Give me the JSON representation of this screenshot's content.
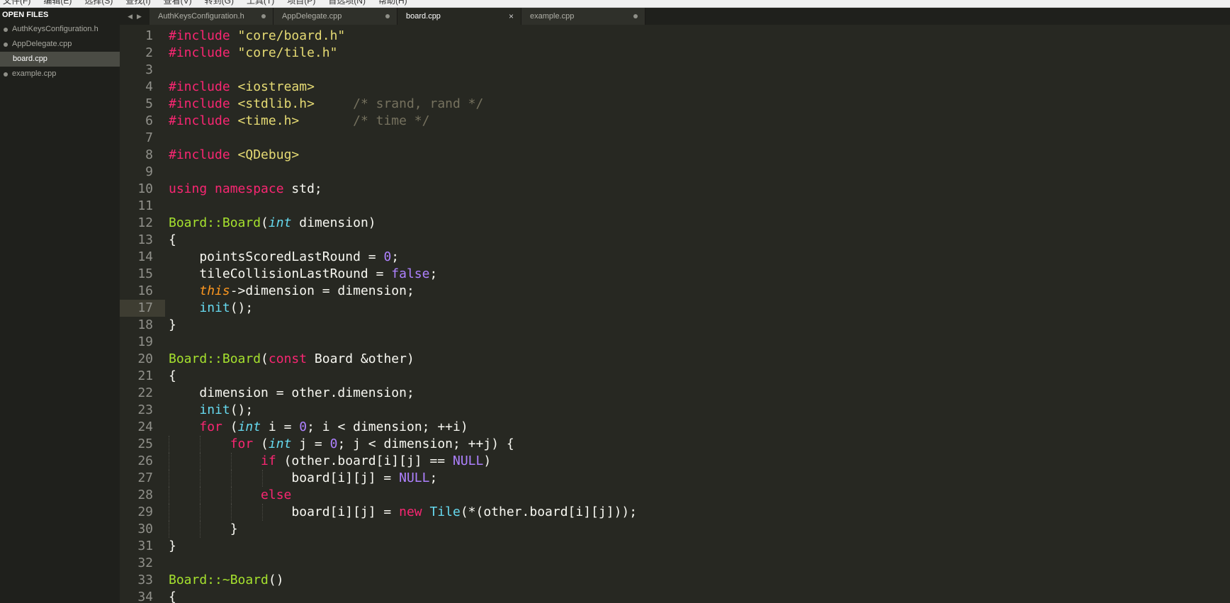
{
  "menu": [
    "文件(F)",
    "编辑(E)",
    "选择(S)",
    "查找(I)",
    "查看(V)",
    "转到(G)",
    "工具(T)",
    "项目(P)",
    "首选项(N)",
    "帮助(H)"
  ],
  "sidebar": {
    "header": "OPEN FILES",
    "files": [
      {
        "name": "AuthKeysConfiguration.h",
        "active": false
      },
      {
        "name": "AppDelegate.cpp",
        "active": false
      },
      {
        "name": "board.cpp",
        "active": true
      },
      {
        "name": "example.cpp",
        "active": false
      }
    ]
  },
  "tabs": [
    {
      "name": "AuthKeysConfiguration.h",
      "active": false
    },
    {
      "name": "AppDelegate.cpp",
      "active": false
    },
    {
      "name": "board.cpp",
      "active": true,
      "close": "×"
    },
    {
      "name": "example.cpp",
      "active": false
    }
  ],
  "editor": {
    "current_line": 17,
    "lines": [
      [
        [
          "kw",
          "#include"
        ],
        [
          "pl",
          " "
        ],
        [
          "str",
          "\"core/board.h\""
        ]
      ],
      [
        [
          "kw",
          "#include"
        ],
        [
          "pl",
          " "
        ],
        [
          "str",
          "\"core/tile.h\""
        ]
      ],
      [],
      [
        [
          "kw",
          "#include"
        ],
        [
          "pl",
          " "
        ],
        [
          "str",
          "<iostream>"
        ]
      ],
      [
        [
          "kw",
          "#include"
        ],
        [
          "pl",
          " "
        ],
        [
          "str",
          "<stdlib.h>"
        ],
        [
          "pl",
          "     "
        ],
        [
          "cm",
          "/* srand, rand */"
        ]
      ],
      [
        [
          "kw",
          "#include"
        ],
        [
          "pl",
          " "
        ],
        [
          "str",
          "<time.h>"
        ],
        [
          "pl",
          "       "
        ],
        [
          "cm",
          "/* time */"
        ]
      ],
      [],
      [
        [
          "kw",
          "#include"
        ],
        [
          "pl",
          " "
        ],
        [
          "str",
          "<QDebug>"
        ]
      ],
      [],
      [
        [
          "kw",
          "using"
        ],
        [
          "pl",
          " "
        ],
        [
          "kw",
          "namespace"
        ],
        [
          "pl",
          " std;"
        ]
      ],
      [],
      [
        [
          "fn",
          "Board::Board"
        ],
        [
          "pl",
          "("
        ],
        [
          "ty",
          "int"
        ],
        [
          "pl",
          " dimension)"
        ]
      ],
      [
        [
          "pl",
          "{"
        ]
      ],
      [
        [
          "pl",
          "    pointsScoredLastRound = "
        ],
        [
          "num",
          "0"
        ],
        [
          "pl",
          ";"
        ]
      ],
      [
        [
          "pl",
          "    tileCollisionLastRound = "
        ],
        [
          "num",
          "false"
        ],
        [
          "pl",
          ";"
        ]
      ],
      [
        [
          "pl",
          "    "
        ],
        [
          "this",
          "this"
        ],
        [
          "pl",
          "->dimension = dimension;"
        ]
      ],
      [
        [
          "pl",
          "    "
        ],
        [
          "call",
          "init"
        ],
        [
          "pl",
          "();"
        ]
      ],
      [
        [
          "pl",
          "}"
        ]
      ],
      [],
      [
        [
          "fn",
          "Board::Board"
        ],
        [
          "pl",
          "("
        ],
        [
          "kw",
          "const"
        ],
        [
          "pl",
          " Board &other)"
        ]
      ],
      [
        [
          "pl",
          "{"
        ]
      ],
      [
        [
          "pl",
          "    dimension = other.dimension;"
        ]
      ],
      [
        [
          "pl",
          "    "
        ],
        [
          "call",
          "init"
        ],
        [
          "pl",
          "();"
        ]
      ],
      [
        [
          "pl",
          "    "
        ],
        [
          "kw",
          "for"
        ],
        [
          "pl",
          " ("
        ],
        [
          "ty",
          "int"
        ],
        [
          "pl",
          " i = "
        ],
        [
          "num",
          "0"
        ],
        [
          "pl",
          "; i < dimension; ++i)"
        ]
      ],
      [
        [
          "pl",
          "        "
        ],
        [
          "kw",
          "for"
        ],
        [
          "pl",
          " ("
        ],
        [
          "ty",
          "int"
        ],
        [
          "pl",
          " j = "
        ],
        [
          "num",
          "0"
        ],
        [
          "pl",
          "; j < dimension; ++j) {"
        ]
      ],
      [
        [
          "pl",
          "            "
        ],
        [
          "kw",
          "if"
        ],
        [
          "pl",
          " (other.board[i][j] == "
        ],
        [
          "num",
          "NULL"
        ],
        [
          "pl",
          ")"
        ]
      ],
      [
        [
          "pl",
          "                board[i][j] = "
        ],
        [
          "num",
          "NULL"
        ],
        [
          "pl",
          ";"
        ]
      ],
      [
        [
          "pl",
          "            "
        ],
        [
          "kw",
          "else"
        ]
      ],
      [
        [
          "pl",
          "                board[i][j] = "
        ],
        [
          "kw",
          "new"
        ],
        [
          "pl",
          " "
        ],
        [
          "call",
          "Tile"
        ],
        [
          "pl",
          "(*(other.board[i][j]));"
        ]
      ],
      [
        [
          "pl",
          "        }"
        ]
      ],
      [
        [
          "pl",
          "}"
        ]
      ],
      [],
      [
        [
          "fn",
          "Board::~Board"
        ],
        [
          "pl",
          "()"
        ]
      ],
      [
        [
          "pl",
          "{"
        ]
      ]
    ]
  }
}
